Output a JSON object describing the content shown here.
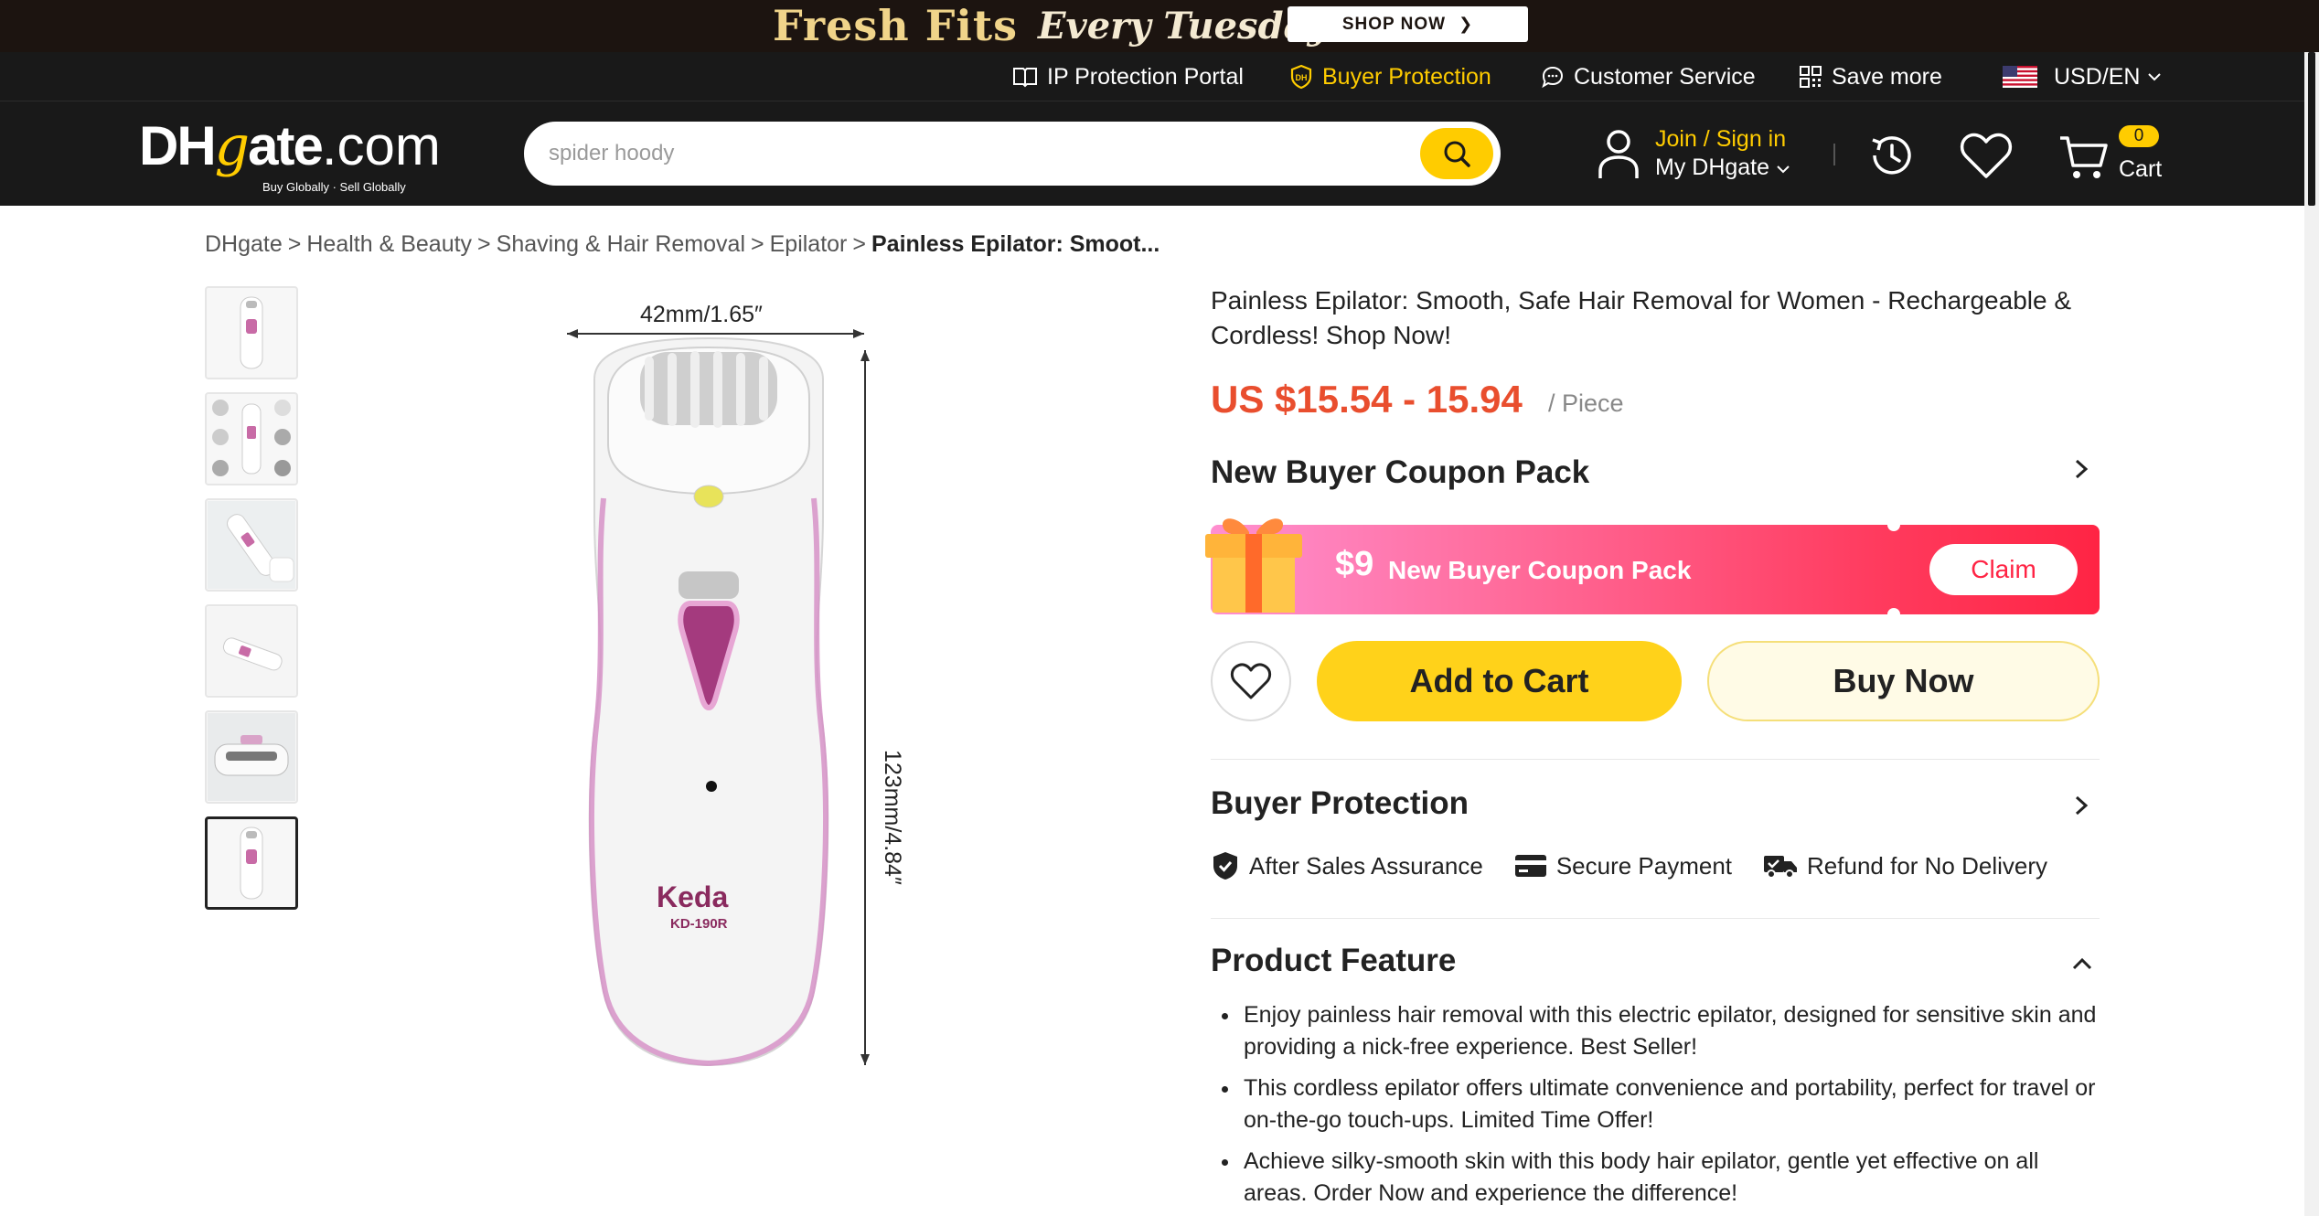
{
  "promo": {
    "title": "Fresh Fits",
    "subtitle": "Every Tuesday",
    "button": "SHOP NOW"
  },
  "utility": {
    "ip_protection": "IP Protection Portal",
    "buyer_protection": "Buyer Protection",
    "customer_service": "Customer Service",
    "save_more": "Save more",
    "currency_lang": "USD/EN"
  },
  "header": {
    "logo_main_dh": "DH",
    "logo_main_g": "g",
    "logo_main_rest": "ate",
    "logo_main_com": ".com",
    "logo_tag": "Buy Globally · Sell Globally",
    "search_placeholder": "spider hoody",
    "join": "Join / Sign in",
    "my_dhgate": "My DHgate",
    "cart_count": "0",
    "cart_label": "Cart"
  },
  "breadcrumb": {
    "items": [
      "DHgate",
      "Health & Beauty",
      "Shaving & Hair Removal",
      "Epilator"
    ],
    "separator": ">",
    "current": "Painless Epilator: Smoot..."
  },
  "gallery": {
    "width_label": "42mm/1.65″",
    "height_label": "123mm/4.84″",
    "brand": "Keda",
    "model": "KD-190R",
    "thumb_count": 6,
    "active_thumb": 6
  },
  "product": {
    "title": "Painless Epilator: Smooth, Safe Hair Removal for Women - Rechargeable & Cordless! Shop Now!",
    "price": "US $15.54 - 15.94",
    "unit": "/ Piece",
    "coupon_section_title": "New Buyer Coupon Pack",
    "coupon_amount": "$9",
    "coupon_text": "New Buyer Coupon Pack",
    "claim": "Claim",
    "add_to_cart": "Add to Cart",
    "buy_now": "Buy Now",
    "buyer_protection_title": "Buyer Protection",
    "protections": [
      "After Sales Assurance",
      "Secure Payment",
      "Refund for No Delivery"
    ],
    "feature_title": "Product Feature",
    "features": [
      "Enjoy painless hair removal with this electric epilator, designed for sensitive skin and providing a nick-free experience. Best Seller!",
      "This cordless epilator offers ultimate convenience and portability, perfect for travel or on-the-go touch-ups. Limited Time Offer!",
      "Achieve silky-smooth skin with this body hair epilator, gentle yet effective on all areas. Order Now and experience the difference!"
    ]
  },
  "colors": {
    "accent": "#ffcc00",
    "header_bg": "#191919",
    "price": "#e94e2e",
    "coupon_gradient_end": "#ff2444"
  }
}
